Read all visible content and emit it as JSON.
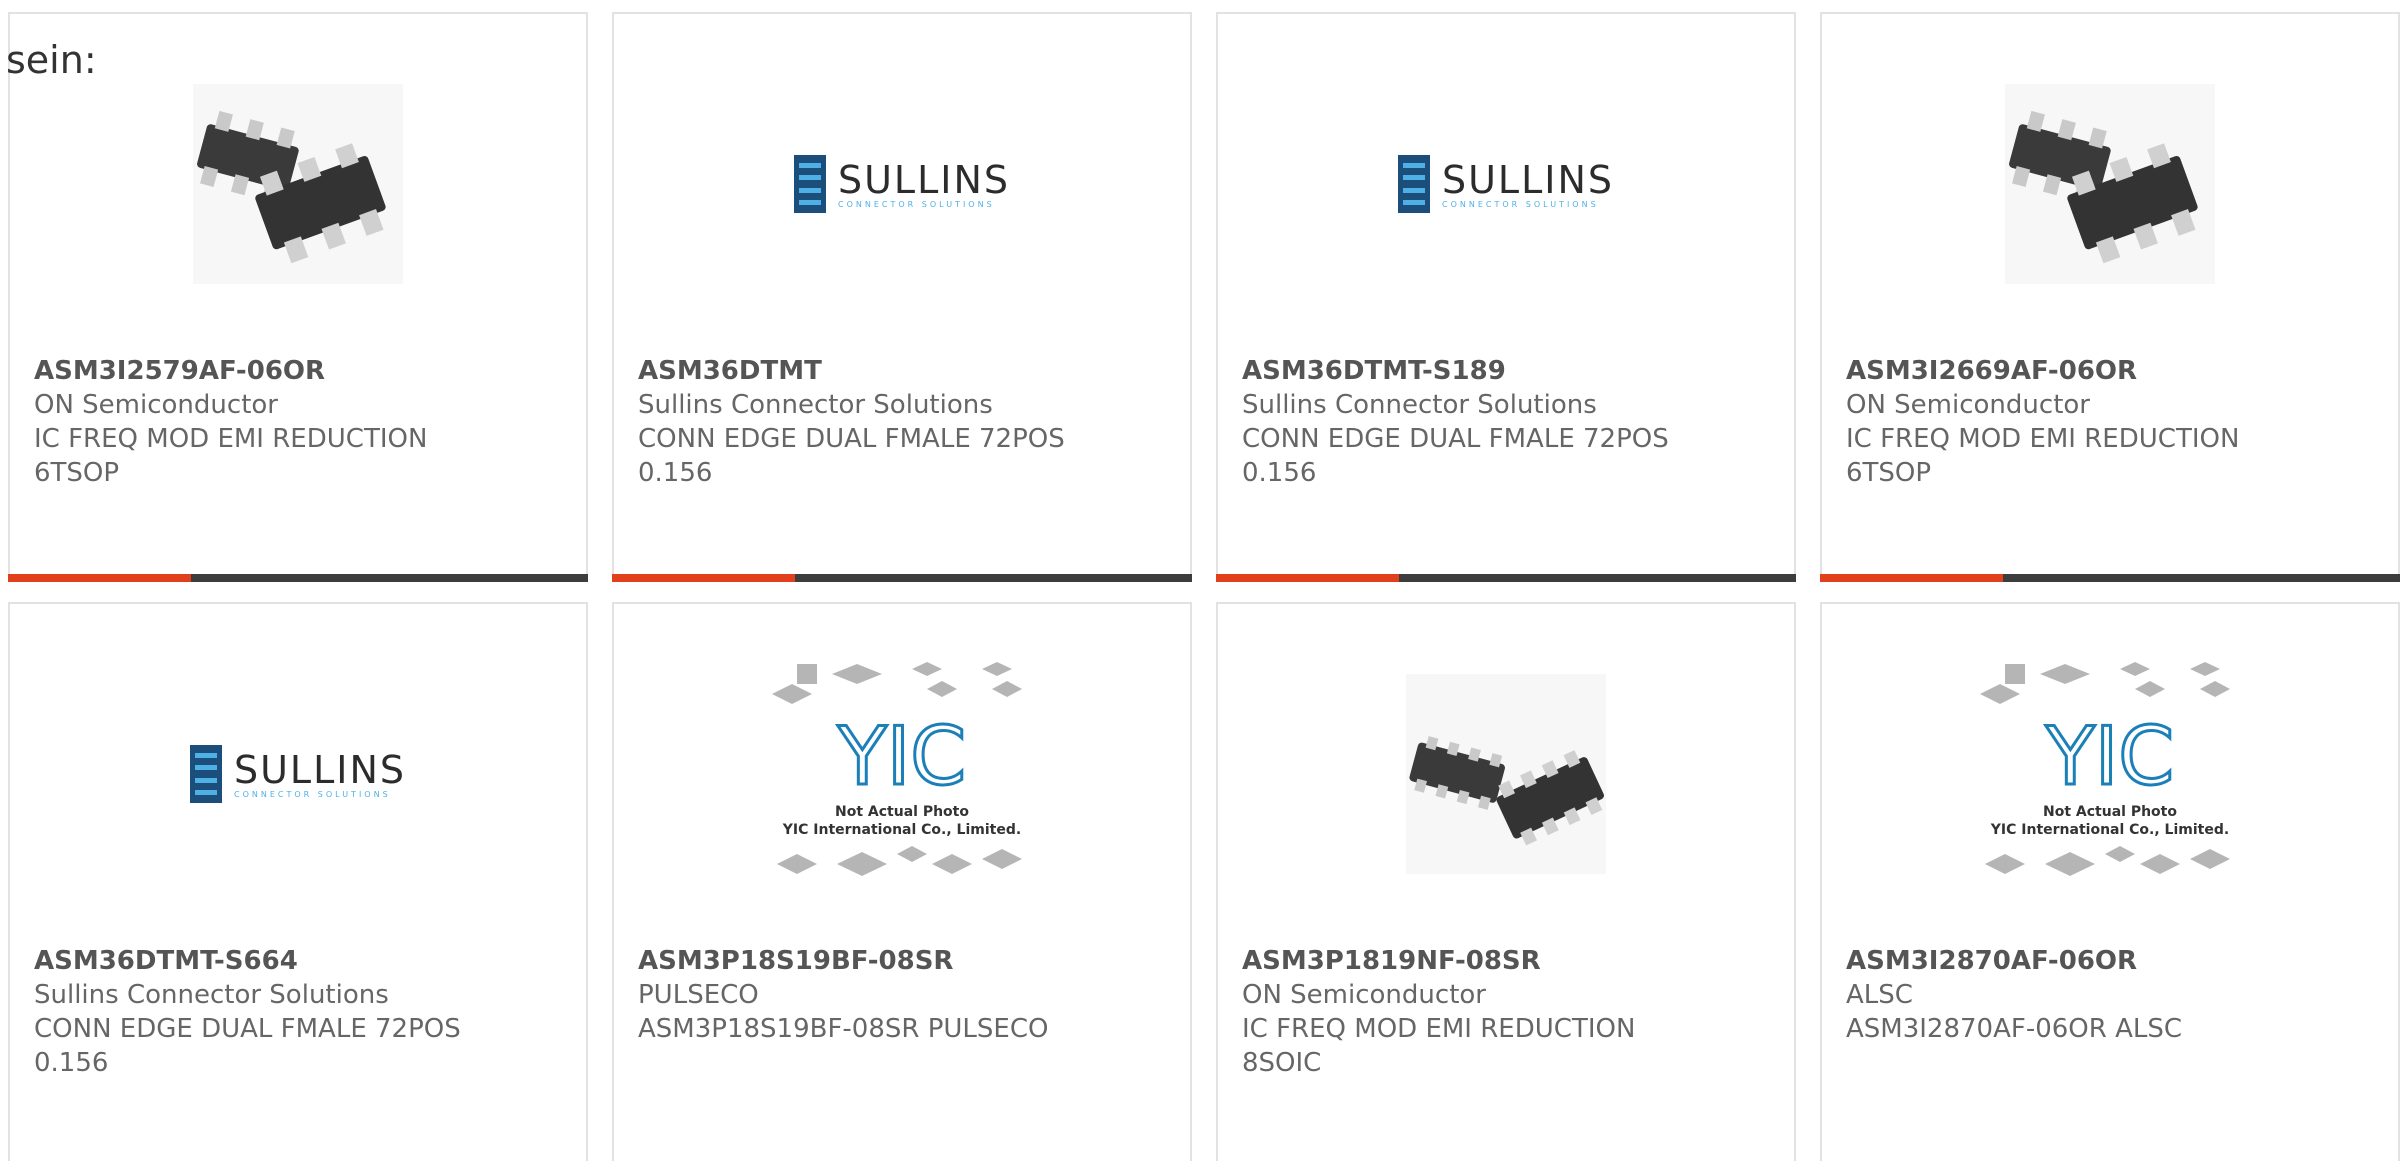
{
  "intro_text": "sein:",
  "placeholder": {
    "line1": "Not Actual Photo",
    "line2": "YIC International Co., Limited.",
    "logo": "YIC"
  },
  "sullins_logo": {
    "name": "SULLINS",
    "tagline": "Connector Solutions"
  },
  "colors": {
    "accent_red": "#e2401c",
    "bar_dark": "#3d3d3d",
    "sullins_blue": "#1b4e7a",
    "sullins_light_blue": "#4fb0e6"
  },
  "products": [
    {
      "part_number": "ASM3I2579AF-06OR",
      "manufacturer": "ON Semiconductor",
      "desc1": "IC FREQ MOD EMI REDUCTION",
      "desc2": "6TSOP",
      "image": "tsop-chip-icon"
    },
    {
      "part_number": "ASM36DTMT",
      "manufacturer": "Sullins Connector Solutions",
      "desc1": "CONN EDGE DUAL FMALE 72POS",
      "desc2": "0.156",
      "image": "sullins-logo"
    },
    {
      "part_number": "ASM36DTMT-S189",
      "manufacturer": "Sullins Connector Solutions",
      "desc1": "CONN EDGE DUAL FMALE 72POS",
      "desc2": "0.156",
      "image": "sullins-logo"
    },
    {
      "part_number": "ASM3I2669AF-06OR",
      "manufacturer": "ON Semiconductor",
      "desc1": "IC FREQ MOD EMI REDUCTION",
      "desc2": "6TSOP",
      "image": "tsop-chip-icon"
    },
    {
      "part_number": "ASM36DTMT-S664",
      "manufacturer": "Sullins Connector Solutions",
      "desc1": "CONN EDGE DUAL FMALE 72POS",
      "desc2": "0.156",
      "image": "sullins-logo"
    },
    {
      "part_number": "ASM3P18S19BF-08SR",
      "manufacturer": "PULSECO",
      "desc1": "ASM3P18S19BF-08SR PULSECO",
      "desc2": "",
      "image": "not-actual-photo"
    },
    {
      "part_number": "ASM3P1819NF-08SR",
      "manufacturer": "ON Semiconductor",
      "desc1": "IC FREQ MOD EMI REDUCTION",
      "desc2": "8SOIC",
      "image": "soic-chip-icon"
    },
    {
      "part_number": "ASM3I2870AF-06OR",
      "manufacturer": "ALSC",
      "desc1": "ASM3I2870AF-06OR ALSC",
      "desc2": "",
      "image": "not-actual-photo"
    }
  ]
}
